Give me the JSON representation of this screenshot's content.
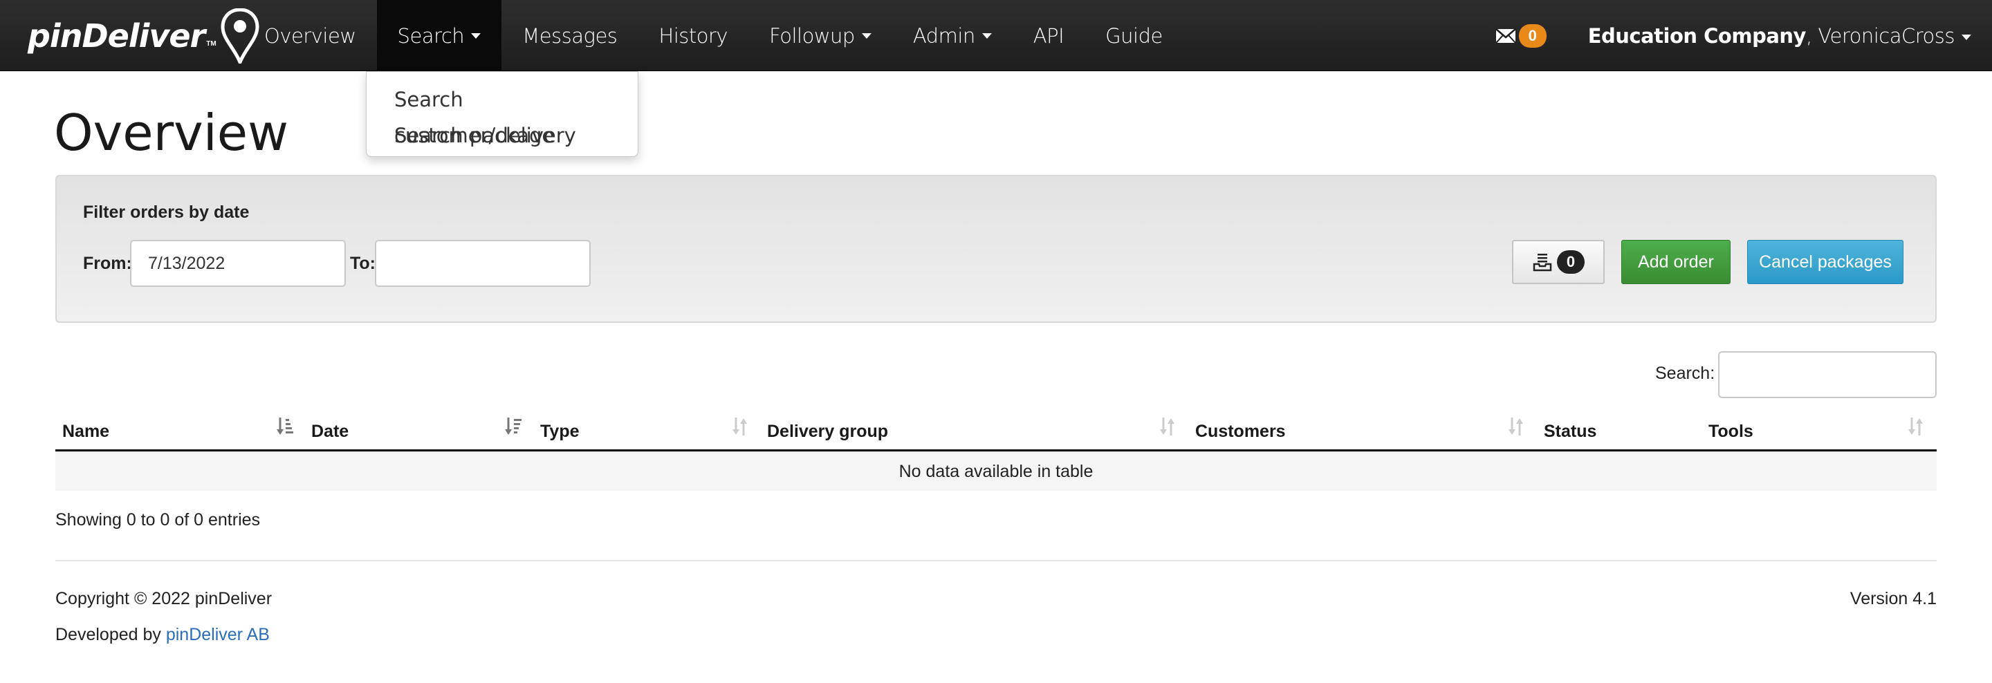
{
  "navbar": {
    "brand": "pinDeliver",
    "brand_tm": "TM",
    "items": [
      {
        "label": "Overview",
        "has_caret": false,
        "active": false
      },
      {
        "label": "Search",
        "has_caret": true,
        "active": true
      },
      {
        "label": "Messages",
        "has_caret": false,
        "active": false
      },
      {
        "label": "History",
        "has_caret": false,
        "active": false
      },
      {
        "label": "Followup",
        "has_caret": true,
        "active": false
      },
      {
        "label": "Admin",
        "has_caret": true,
        "active": false
      },
      {
        "label": "API",
        "has_caret": false,
        "active": false
      },
      {
        "label": "Guide",
        "has_caret": false,
        "active": false
      }
    ],
    "messages_count": "0",
    "company": "Education Company",
    "separator": ", ",
    "username": "VeronicaCross"
  },
  "search_dropdown": {
    "items": [
      "Search customer/delivery",
      "Search package"
    ]
  },
  "page": {
    "title": "Overview"
  },
  "filter": {
    "heading": "Filter orders by date",
    "from_label": "From:",
    "from_value": "7/13/2022",
    "to_label": "To:",
    "to_value": "",
    "inbox_count": "0",
    "add_order_label": "Add order",
    "cancel_packages_label": "Cancel packages"
  },
  "table": {
    "search_label": "Search:",
    "search_value": "",
    "columns": [
      "Name",
      "Date",
      "Type",
      "Delivery group",
      "Customers",
      "Status",
      "Tools"
    ],
    "empty_message": "No data available in table",
    "info": "Showing 0 to 0 of 0 entries"
  },
  "footer": {
    "copyright": "Copyright © 2022 pinDeliver",
    "developed_by": "Developed by ",
    "developer_link": "pinDeliver AB",
    "version": "Version 4.1"
  },
  "colors": {
    "navbar_bg": "#1e1e1e",
    "message_badge": "#e8891a",
    "add_order": "#3f9c35",
    "cancel_packages": "#2f9fcf",
    "link": "#2a6ebb"
  }
}
